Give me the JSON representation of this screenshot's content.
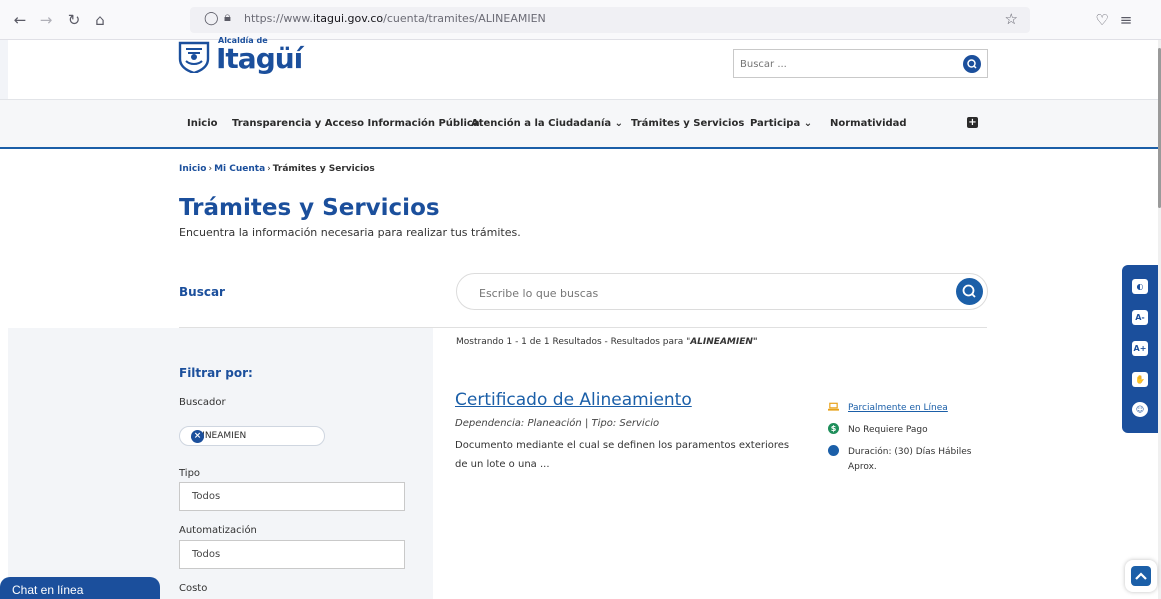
{
  "browser": {
    "url_prefix": "https://www.",
    "url_domain": "itagui.gov.co",
    "url_path": "/cuenta/tramites/ALINEAMIEN"
  },
  "header": {
    "logo_small": "Alcaldía de",
    "logo_text": "Itagüí",
    "search_placeholder": "Buscar ..."
  },
  "nav": {
    "items": [
      "Inicio",
      "Transparencia y Acceso Información Pública",
      "Atención a la Ciudadanía",
      "Trámites y Servicios",
      "Participa",
      "Normatividad"
    ]
  },
  "breadcrumb": {
    "home": "Inicio",
    "account": "Mi Cuenta",
    "current": "Trámites y Servicios",
    "separator": "›"
  },
  "page": {
    "title": "Trámites y Servicios",
    "subtitle": "Encuentra la información necesaria para realizar tus trámites."
  },
  "search": {
    "label": "Buscar",
    "placeholder": "Escribe lo que buscas"
  },
  "filters": {
    "title": "Filtrar por:",
    "buscador_label": "Buscador",
    "chip_value": "ALINEAMIEN",
    "tipo_label": "Tipo",
    "tipo_value": "Todos",
    "auto_label": "Automatización",
    "auto_value": "Todos",
    "costo_label": "Costo"
  },
  "results": {
    "count_text": "Mostrando 1 - 1 de 1 Resultados - Resultados para \"",
    "query": "ALINEAMIEN",
    "count_end": "\"",
    "item": {
      "title": "Certificado de Alineamiento",
      "meta": "Dependencia: Planeación | Tipo: Servicio",
      "description": "Documento mediante el cual se definen los paramentos exteriores de un lote o una ...",
      "online": "Parcialmente en Línea",
      "payment": "No Requiere Pago",
      "duration": "Duración: (30) Días Hábiles Aprox."
    }
  },
  "a11y": {
    "contrast_icon": "◐",
    "font_down": "A-",
    "font_up": "A+",
    "sign_icon": "✋",
    "smile_icon": "☺"
  },
  "chat": {
    "label": "Chat en línea"
  },
  "colors": {
    "brand": "#1b4f9c",
    "accent": "#1b5fa8",
    "payment_icon": "#1e8e5a",
    "online_icon": "#e8a21a"
  }
}
